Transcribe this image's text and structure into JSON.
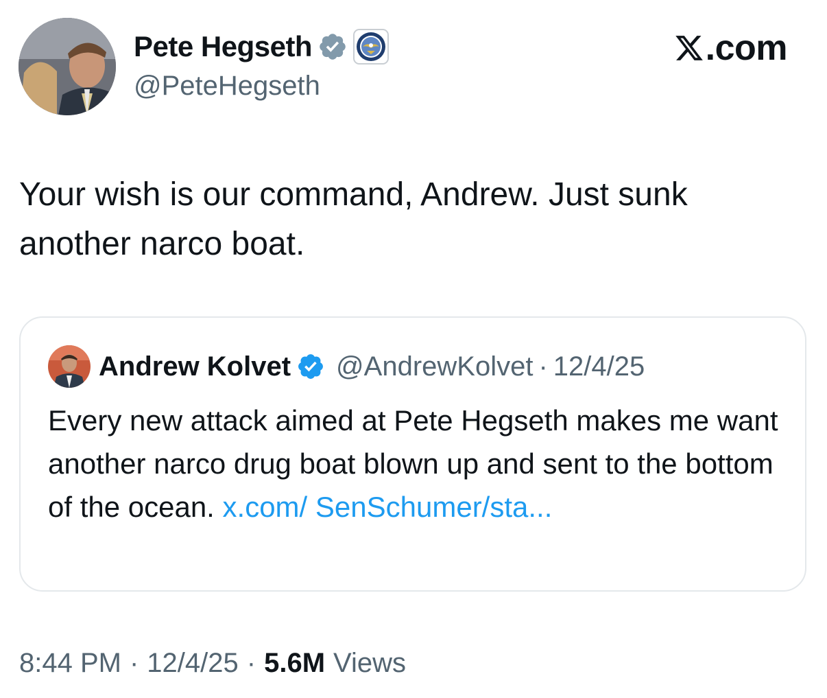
{
  "author": {
    "display_name": "Pete Hegseth",
    "handle": "@PeteHegseth",
    "verified_badge_icon": "verified-badge-icon",
    "affiliation_icon": "department-seal-icon"
  },
  "brand": {
    "label": ".com",
    "logo_icon": "x-logo-icon"
  },
  "tweet": {
    "text": "Your wish is our command, Andrew. Just sunk another narco boat."
  },
  "quote": {
    "display_name": "Andrew Kolvet",
    "handle": "@AndrewKolvet",
    "separator": "·",
    "date": "12/4/25",
    "text": "Every new attack aimed at Pete Hegseth makes me want another narco drug boat blown up and sent to the bottom of the ocean. ",
    "link_text": "x.com/ SenSchumer/sta..."
  },
  "meta": {
    "time": "8:44 PM",
    "separator": "·",
    "date": "12/4/25",
    "views_count": "5.6M",
    "views_label": "Views"
  },
  "colors": {
    "text_primary": "#0f1419",
    "text_secondary": "#536471",
    "link": "#1d9bf0",
    "verified_blue_check": "#1d9bf0",
    "verified_gray_check": "#829aab",
    "card_border": "#e4e8eb"
  }
}
